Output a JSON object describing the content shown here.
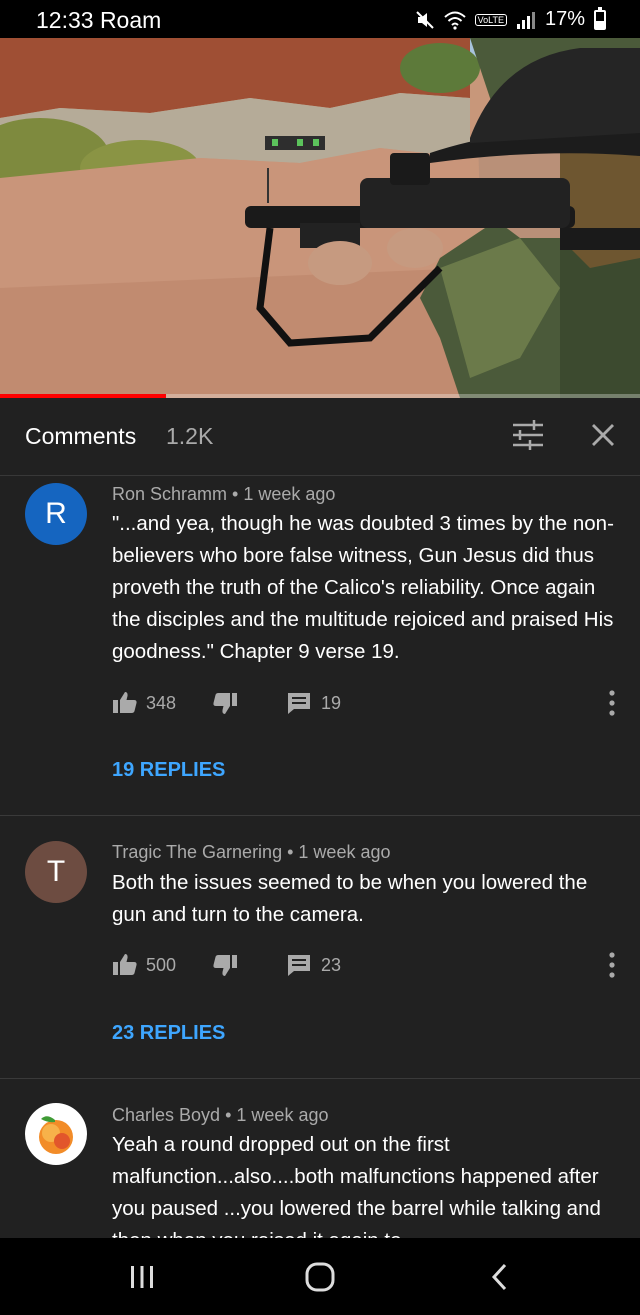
{
  "status_bar": {
    "time": "12:33 Roam",
    "volte": "VoLTE",
    "battery": "17%"
  },
  "video": {
    "progress_fraction": 0.26
  },
  "comments_header": {
    "title": "Comments",
    "count": "1.2K",
    "icons": [
      "filter-icon",
      "close-icon"
    ]
  },
  "comments": [
    {
      "avatar_letter": "R",
      "avatar_color": "#1565c0",
      "author": "Ron Schramm",
      "time": "1 week ago",
      "text": "\"...and yea, though he was doubted 3 times by the non-believers who bore false witness, Gun Jesus did thus proveth the truth of the Calico's reliability. Once again the disciples and the multitude rejoiced and praised His goodness.\"  Chapter 9 verse 19.",
      "likes": "348",
      "reply_count": "19",
      "replies_label": "19 REPLIES"
    },
    {
      "avatar_letter": "T",
      "avatar_color": "#6d4c41",
      "author": "Tragic The Garnering",
      "time": "1 week ago",
      "text": "Both the issues seemed to be when you lowered the gun and turn to the camera.",
      "likes": "500",
      "reply_count": "23",
      "replies_label": "23 REPLIES"
    },
    {
      "avatar_letter": "",
      "avatar_color": "#ffffff",
      "author": "Charles Boyd",
      "time": "1 week ago",
      "text": "Yeah a round dropped out on the first malfunction...also....both malfunctions happened after you paused ...you lowered the barrel while talking and then when you raised it again to"
    }
  ],
  "separator": "•",
  "nav_bar": {
    "icons": [
      "recent-apps-icon",
      "home-icon",
      "back-icon"
    ]
  },
  "colors": {
    "background": "#212121",
    "link": "#3ea6ff",
    "progress": "#ff0000"
  }
}
